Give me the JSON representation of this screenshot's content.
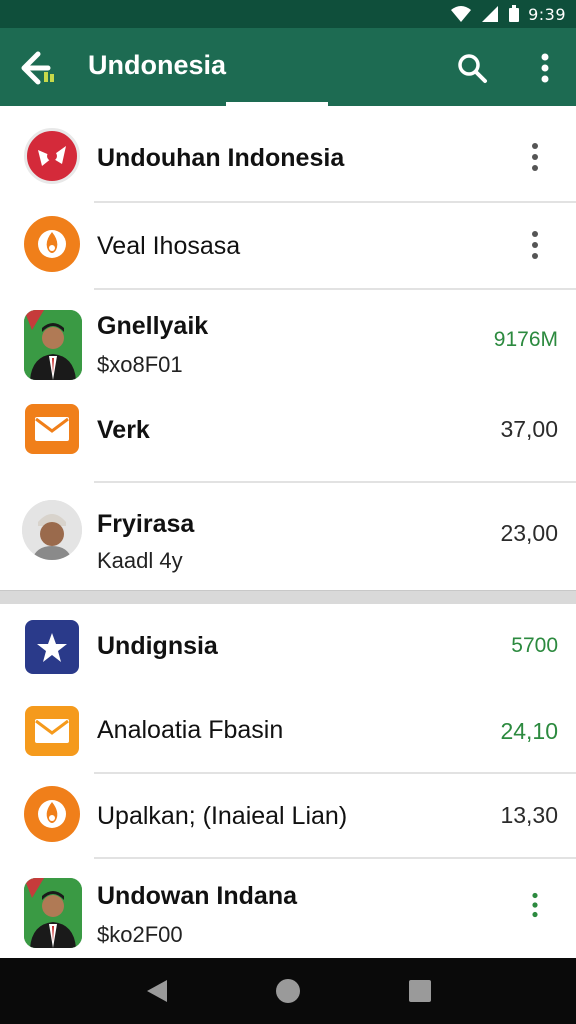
{
  "status_bar": {
    "time": "9:39"
  },
  "app_bar": {
    "title": "Undonesia"
  },
  "list_one": [
    {
      "title": "Undouhan Indonesia",
      "value": "",
      "subtitle": ""
    },
    {
      "title": "Veal Ihosasa",
      "value": "",
      "subtitle": ""
    },
    {
      "title": "Gnellyaik",
      "subtitle": "$xo8F01",
      "value": "9176M"
    },
    {
      "title": "Verk",
      "subtitle": "",
      "value": "37,00"
    },
    {
      "title": "Fryirasa",
      "subtitle": "Kaadl 4y",
      "value": "23,00"
    }
  ],
  "list_two": [
    {
      "title": "Undignsia",
      "subtitle": "",
      "value": "5700"
    },
    {
      "title": "Analoatia Fbasin",
      "subtitle": "",
      "value": "24,10"
    },
    {
      "title": "Upalkan; (Inaieal Lian)",
      "subtitle": "",
      "value": "13,30"
    },
    {
      "title": "Undowan Indana",
      "subtitle": "$ko2F00",
      "value": ""
    }
  ],
  "colors": {
    "app_bar": "#1d6b52",
    "status_bar": "#0f4f3b",
    "positive_value": "#2c8a3f",
    "red_icon": "#d42a3a",
    "orange_icon": "#f07f1a",
    "navy_icon": "#2a3a8a"
  },
  "icons": {
    "back": "arrow-back-icon",
    "search": "search-icon",
    "more": "more-vertical-icon"
  }
}
